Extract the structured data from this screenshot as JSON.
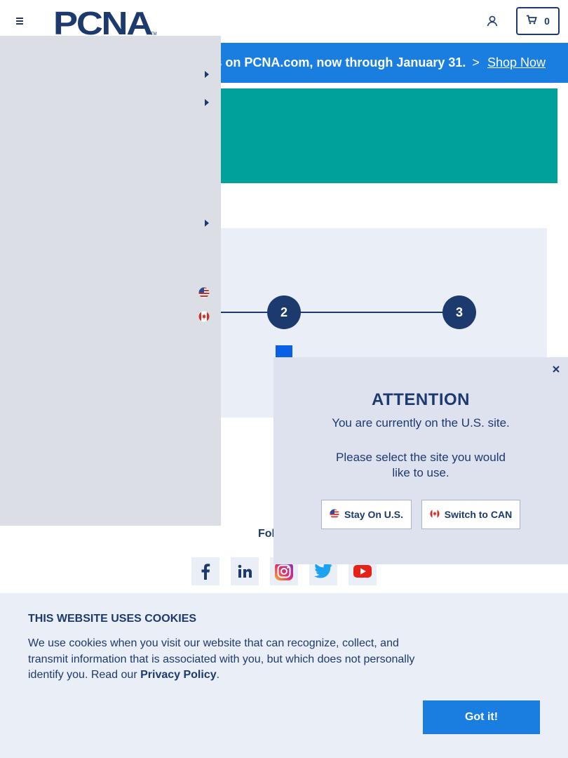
{
  "header": {
    "logo_text": "PCNA",
    "logo_tm": "TM",
    "cart_count": "0",
    "menu_icon": "hamburger-menu-icon",
    "account_icon": "user-icon",
    "cart_icon": "cart-icon"
  },
  "promo": {
    "text": "s on PCNA.com, now through January 31.",
    "separator": ">",
    "link_label": "Shop Now"
  },
  "steps": {
    "labels": [
      "2",
      "3"
    ]
  },
  "social": {
    "follow_label": "Fol",
    "icons": [
      "facebook-icon",
      "linkedin-icon",
      "instagram-icon",
      "twitter-icon",
      "youtube-icon"
    ]
  },
  "drawer": {
    "flags": [
      "us-flag-icon",
      "canada-flag-icon"
    ]
  },
  "modal": {
    "title": "ATTENTION",
    "text_current": "You are currently on the U.S. site.",
    "text_select": "Please select the site you would like to use.",
    "stay_label": "Stay On U.S.",
    "switch_label": "Switch to CAN"
  },
  "cookie": {
    "title": "THIS WEBSITE USES COOKIES",
    "text_before": "We use cookies when you visit our website that can recognize, collect, and transmit information that is associated with you, but which does not personally identify you. Read our ",
    "link_label": "Privacy Policy",
    "text_after": ".",
    "button_label": "Got it!"
  },
  "colors": {
    "navy": "#1d3a6e",
    "promo_blue": "#1a7de0",
    "teal": "#00a19a",
    "panel": "#e9eef7",
    "drawer": "#dcdee6"
  }
}
